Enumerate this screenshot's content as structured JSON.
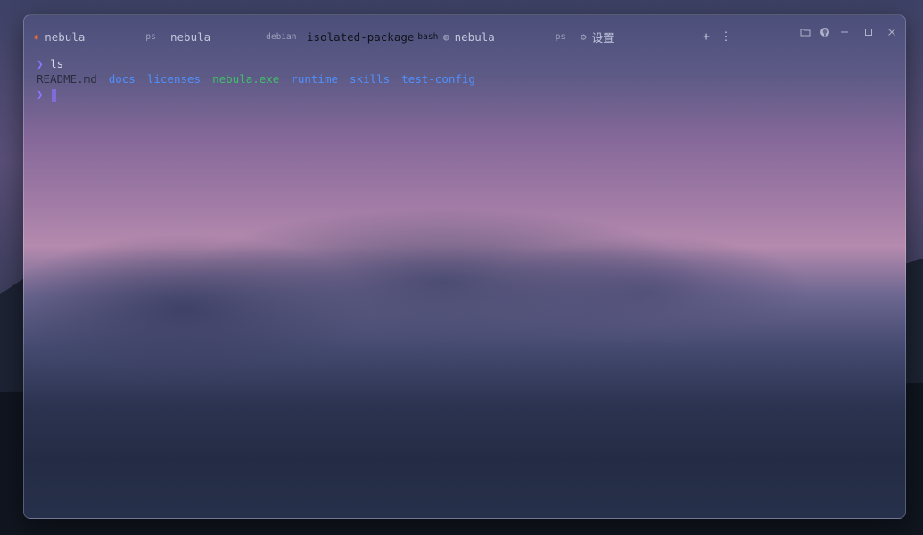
{
  "tabs": [
    {
      "icon": "sun-icon",
      "label": "nebula",
      "tag": "ps",
      "active": false
    },
    {
      "icon": "",
      "label": "nebula",
      "tag": "debian",
      "active": false
    },
    {
      "icon": "",
      "label": "isolated-package",
      "tag": "bash",
      "active": true
    },
    {
      "icon": "globe-icon",
      "label": "nebula",
      "tag": "ps",
      "active": false
    },
    {
      "icon": "gear-icon",
      "label": "设置",
      "tag": "",
      "active": false
    }
  ],
  "toolbar": {
    "new_tab": "+",
    "more": "⋮"
  },
  "terminal": {
    "prompt_symbol": "❯",
    "command": "ls",
    "entries": [
      {
        "name": "README.md",
        "kind": "file"
      },
      {
        "name": "docs",
        "kind": "dir"
      },
      {
        "name": "licenses",
        "kind": "dir"
      },
      {
        "name": "nebula.exe",
        "kind": "exe"
      },
      {
        "name": "runtime",
        "kind": "dir"
      },
      {
        "name": "skills",
        "kind": "dir"
      },
      {
        "name": "test-config",
        "kind": "dir"
      }
    ]
  },
  "colors": {
    "prompt": "#8b76ff",
    "dir": "#4f90ff",
    "exe": "#3fc06a",
    "file": "#2a2d3e",
    "accent_icon": "#ff6a33"
  }
}
